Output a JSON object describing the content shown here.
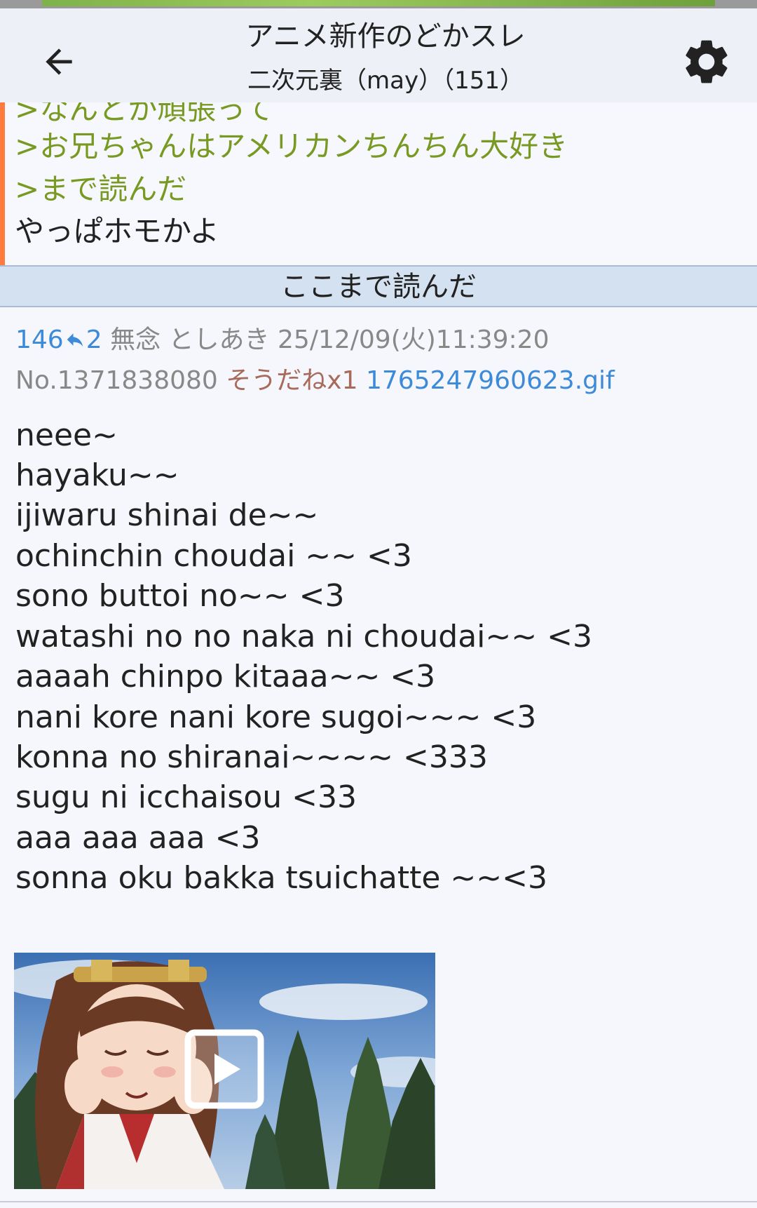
{
  "header": {
    "back_icon": "arrow-left-icon",
    "title": "アニメ新作のどかスレ",
    "subtitle": "二次元裏（may）（151）",
    "settings_icon": "gear-icon"
  },
  "prev_post": {
    "lines": [
      {
        "text": ">なんとか頑張って",
        "kind": "quote"
      },
      {
        "text": ">お兄ちゃんはアメリカンちんちん大好き",
        "kind": "quote"
      },
      {
        "text": ">まで読んだ",
        "kind": "quote"
      },
      {
        "text": "やっぱホモかよ",
        "kind": "plain"
      }
    ],
    "accent_color": "#ff7a3d",
    "quote_color": "#789922"
  },
  "read_marker": {
    "label": "ここまで読んだ"
  },
  "post": {
    "index": "146",
    "reply_count": "2",
    "reply_icon": "reply-arrow-icon",
    "name": "無念",
    "email": "としあき",
    "datetime": "25/12/09(火)11:39:20",
    "number": "No.1371838080",
    "sodane": "そうだねx1",
    "file_name": "1765247960623.gif",
    "body": [
      "neee~",
      "hayaku~~",
      "ijiwaru shinai de~~",
      "ochinchin choudai ~~ <3",
      "sono buttoi no~~ <3",
      "watashi no no naka ni choudai~~ <3",
      "aaaah chinpo kitaaa~~ <3",
      "nani kore nani kore sugoi~~~ <3",
      "konna no shiranai~~~~ <333",
      "sugu ni icchaisou <33",
      "aaa aaa aaa <3",
      "sonna oku bakka tsuichatte ~~<3"
    ],
    "thumbnail": {
      "play_icon": "play-icon"
    },
    "link_color": "#3d8ad9"
  }
}
